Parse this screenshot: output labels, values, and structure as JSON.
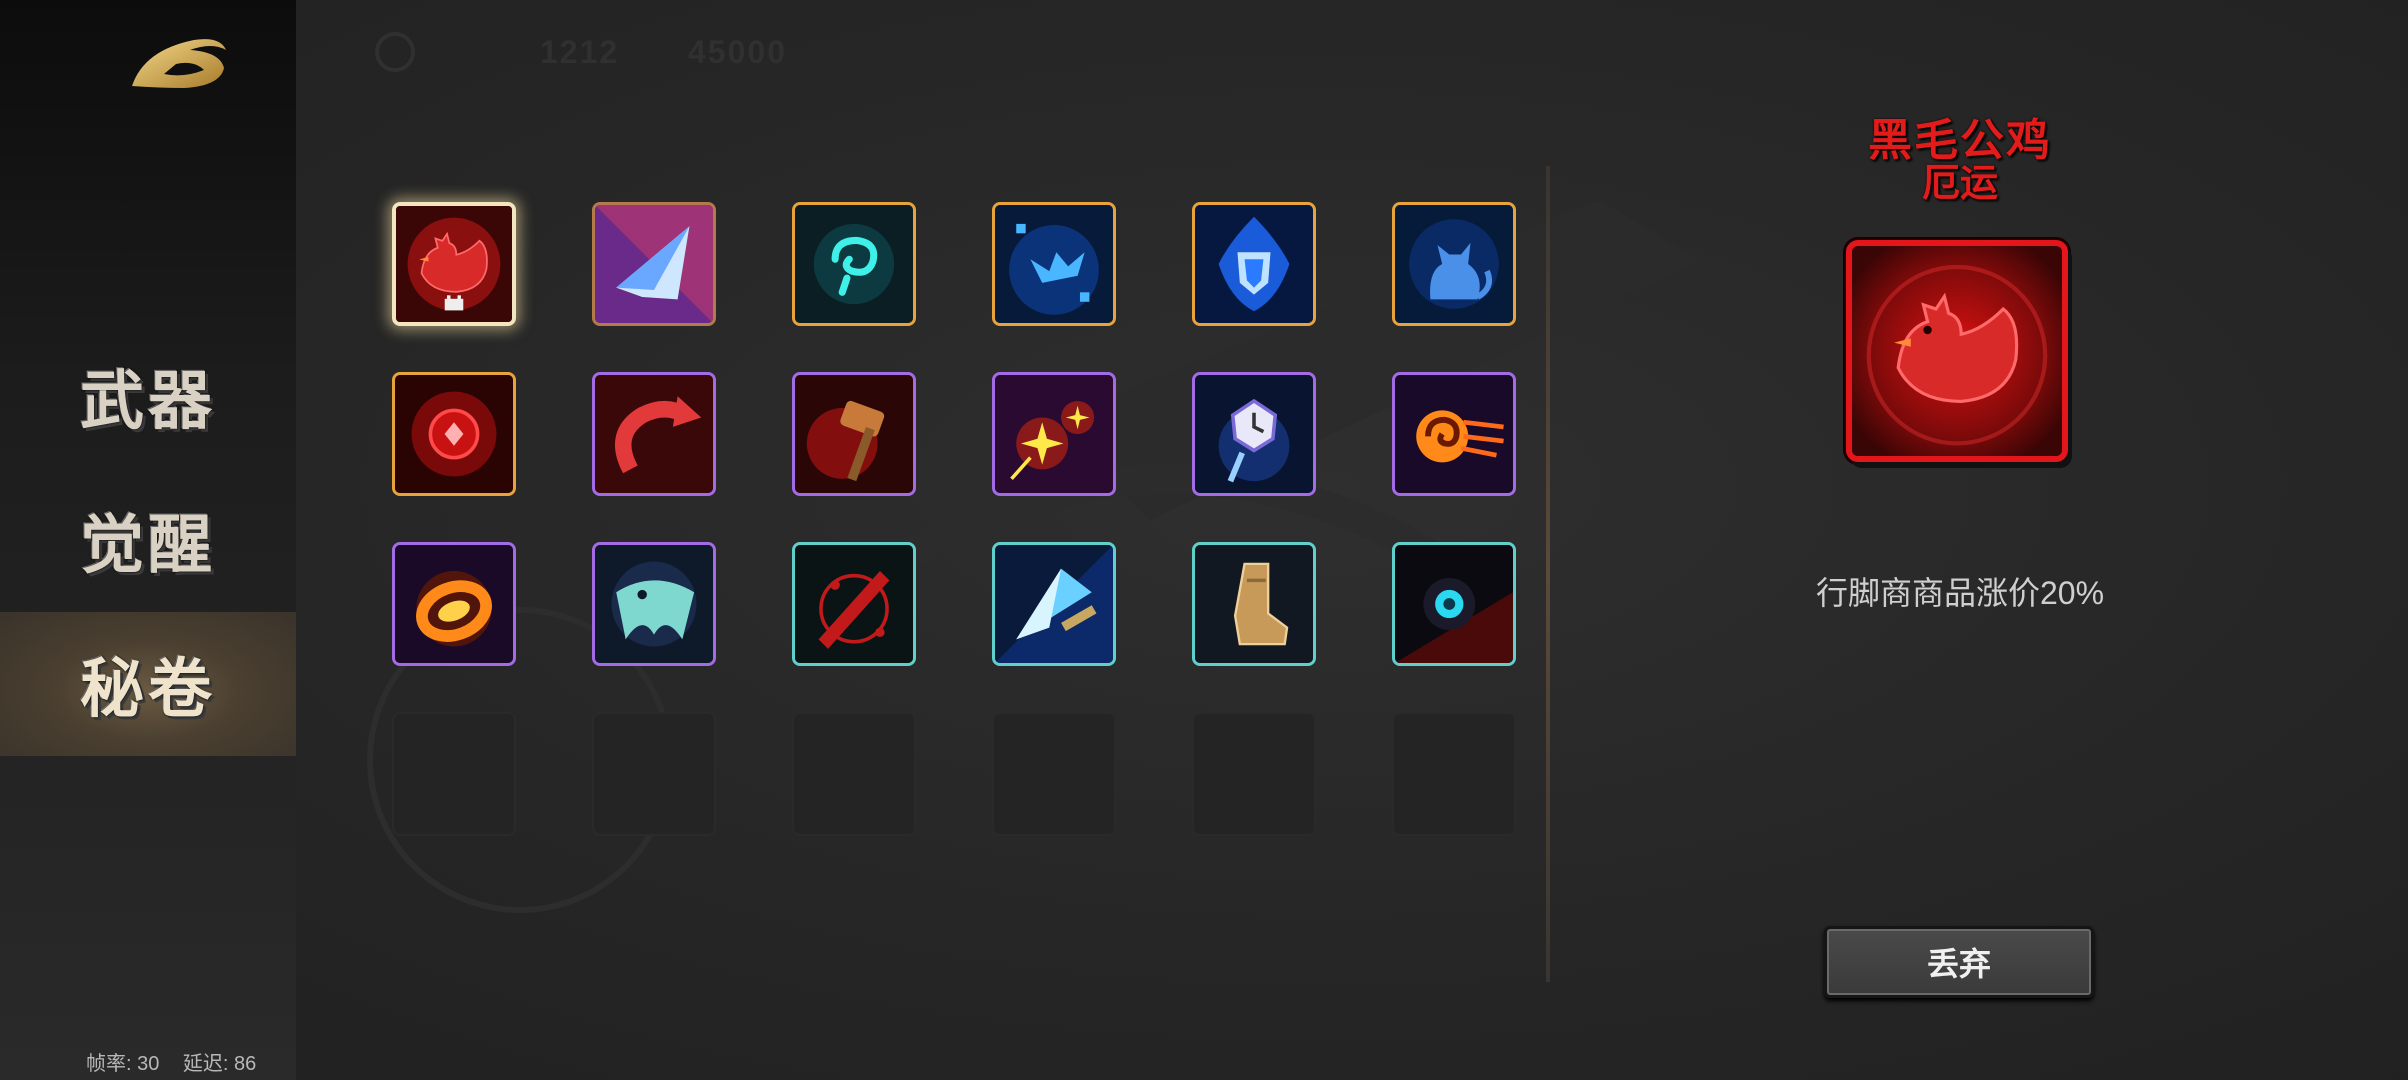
{
  "header": {
    "faded_numbers": [
      "1212",
      "45000"
    ]
  },
  "sidebar": {
    "items": [
      {
        "label": "武器",
        "active": false
      },
      {
        "label": "觉醒",
        "active": false
      },
      {
        "label": "秘卷",
        "active": true
      }
    ],
    "stats": {
      "fps_label": "帧率: 30",
      "latency_label": "延迟: 86"
    }
  },
  "grid": {
    "rows": [
      [
        {
          "icon": "black-rooster-icon",
          "border": "selected",
          "selected": true
        },
        {
          "icon": "crystal-blade-icon",
          "border": "bronze"
        },
        {
          "icon": "teal-spiral-icon",
          "border": "orange"
        },
        {
          "icon": "blue-fragments-icon",
          "border": "orange"
        },
        {
          "icon": "blue-shield-flame-icon",
          "border": "orange"
        },
        {
          "icon": "blue-cat-icon",
          "border": "orange"
        }
      ],
      [
        {
          "icon": "red-orb-icon",
          "border": "orange"
        },
        {
          "icon": "red-curved-arrow-icon",
          "border": "purple"
        },
        {
          "icon": "fire-hammer-icon",
          "border": "purple"
        },
        {
          "icon": "twin-sparks-icon",
          "border": "purple"
        },
        {
          "icon": "pocket-watch-icon",
          "border": "purple"
        },
        {
          "icon": "fire-spiral-icon",
          "border": "purple"
        }
      ],
      [
        {
          "icon": "fire-ring-icon",
          "border": "purple"
        },
        {
          "icon": "teal-wing-icon",
          "border": "purple"
        },
        {
          "icon": "red-sword-icon",
          "border": "teal"
        },
        {
          "icon": "blue-dagger-icon",
          "border": "teal"
        },
        {
          "icon": "golden-boot-icon",
          "border": "teal"
        },
        {
          "icon": "dark-eye-orb-icon",
          "border": "teal"
        }
      ],
      [
        {
          "icon": "empty-slot"
        },
        {
          "icon": "empty-slot"
        },
        {
          "icon": "empty-slot"
        },
        {
          "icon": "empty-slot"
        },
        {
          "icon": "empty-slot"
        },
        {
          "icon": "empty-slot"
        }
      ]
    ]
  },
  "detail": {
    "name": "黑毛公鸡",
    "type": "厄运",
    "icon": "black-rooster-icon",
    "description": "行脚商商品涨价20%",
    "discard_label": "丢弃"
  },
  "colors": {
    "accent_red": "#e21b1b",
    "border_orange": "#e8a33a",
    "border_purple": "#a46be6",
    "border_teal": "#5fd0cc"
  }
}
